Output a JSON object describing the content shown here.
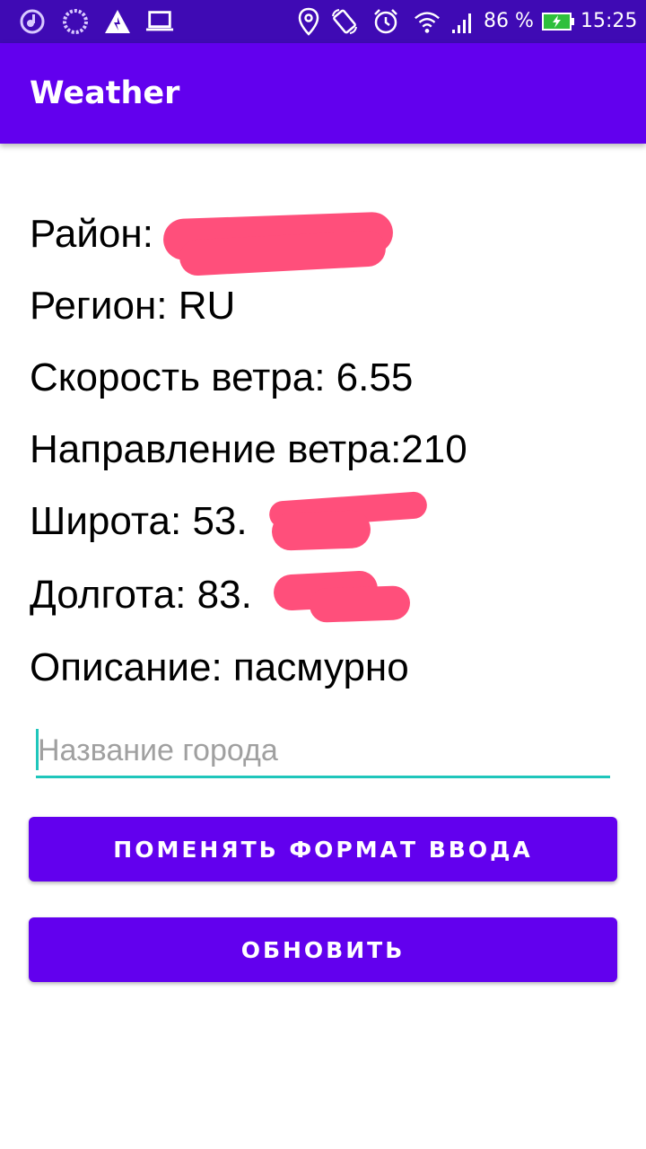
{
  "status_bar": {
    "battery_percent": "86 %",
    "time": "15:25",
    "left_icons": [
      "music-icon",
      "loading-icon",
      "warning-icon",
      "laptop-icon"
    ],
    "right_icons": [
      "location-icon",
      "rotate-icon",
      "alarm-icon",
      "wifi-icon",
      "signal-icon",
      "battery-icon"
    ]
  },
  "app_bar": {
    "title": "Weather"
  },
  "weather": {
    "district_label": "Район:",
    "region": "Регион: RU",
    "wind_speed": "Скорость ветра: 6.55",
    "wind_direction": "Направление ветра:210",
    "latitude": "Широта: 53.",
    "longitude": "Долгота: 83.",
    "description": "Описание: пасмурно"
  },
  "city_input": {
    "placeholder": "Название города",
    "value": ""
  },
  "buttons": {
    "change_format": "ПОМЕНЯТЬ ФОРМАТ ВВОДА",
    "refresh": "ОБНОВИТЬ"
  },
  "colors": {
    "status_bar": "#3f0ab4",
    "primary": "#6200ee",
    "accent": "#1fc6bb",
    "redaction": "#ff4f7b"
  }
}
